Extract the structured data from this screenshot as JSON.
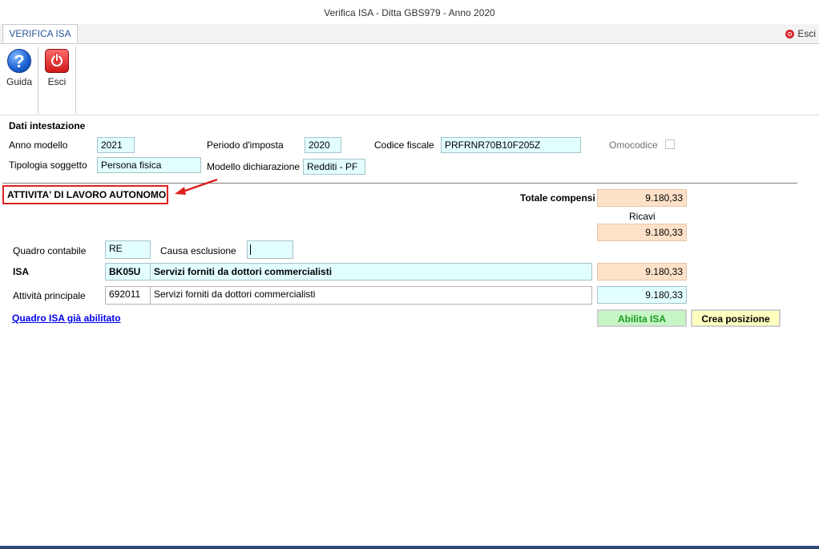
{
  "window": {
    "title": "Verifica ISA - Ditta GBS979 - Anno 2020"
  },
  "tabs": [
    {
      "label": "VERIFICA ISA"
    }
  ],
  "top_right": {
    "esci_label": "Esci"
  },
  "ribbon": {
    "guida_label": "Guida",
    "esci_label": "Esci"
  },
  "dati": {
    "heading": "Dati intestazione",
    "anno_modello_label": "Anno modello",
    "anno_modello_value": "2021",
    "periodo_label": "Periodo d'imposta",
    "periodo_value": "2020",
    "codice_fiscale_label": "Codice fiscale",
    "codice_fiscale_value": "PRFRNR70B10F205Z",
    "omocodice_label": "Omocodice",
    "tipologia_label": "Tipologia soggetto",
    "tipologia_value": "Persona fisica",
    "modello_label": "Modello dichiarazione",
    "modello_value": "Redditi - PF"
  },
  "attivita": {
    "heading": "ATTIVITA' DI LAVORO AUTONOMO",
    "totale_compensi_label": "Totale compensi",
    "totale_compensi_value": "9.180,33",
    "ricavi_label": "Ricavi",
    "ricavi_value": "9.180,33",
    "quadro_contabile_label": "Quadro contabile",
    "quadro_contabile_value": "RE",
    "causa_esclusione_label": "Causa esclusione",
    "causa_esclusione_value": "",
    "isa_label": "ISA",
    "isa_code": "BK05U",
    "isa_desc": "Servizi forniti da dottori commercialisti",
    "isa_value": "9.180,33",
    "attivita_principale_label": "Attività principale",
    "attivita_code": "692011",
    "attivita_desc": "Servizi forniti da dottori commercialisti",
    "attivita_value": "9.180,33",
    "link_label": "Quadro ISA già abilitato",
    "abilita_label": "Abilita ISA",
    "crea_label": "Crea posizione"
  },
  "colors": {
    "accent_tab_text": "#2b579a",
    "field_cyan": "#e2ffff",
    "field_orange": "#fde1c8",
    "highlight_red": "#e02020",
    "button_green": "#c6f5c6",
    "button_yellow": "#ffffc0"
  }
}
